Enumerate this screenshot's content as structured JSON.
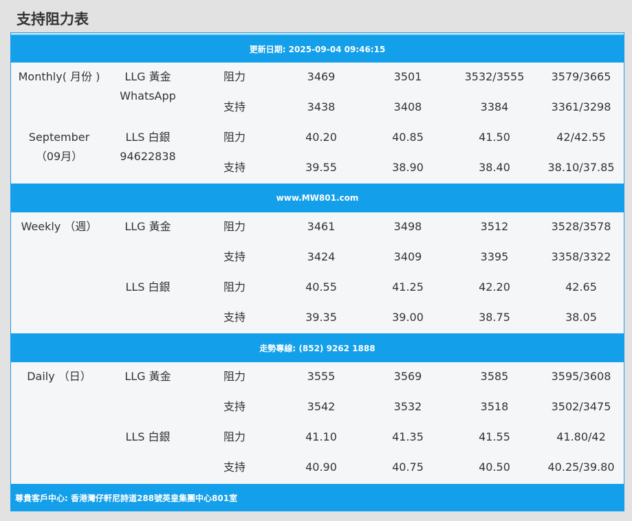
{
  "page_title": "支持阻力表",
  "banners": {
    "updated": "更新日期: 2025-09-04 09:46:15",
    "website": "www.MW801.com",
    "hotline": "走勢專線: (852) 9262 1888",
    "address": "尊貴客戶中心: 香港灣仔軒尼詩道288號英皇集團中心801室"
  },
  "monthly": {
    "period_line1": "Monthly( 月份 )",
    "period_line2": "September",
    "period_line3": "（09月）",
    "gold_label": "LLG 黃金",
    "gold_sub": "WhatsApp",
    "silver_label": "LLS 白銀",
    "silver_sub": "94622838",
    "rows": [
      {
        "type": "阻力",
        "values": [
          "3469",
          "3501",
          "3532/3555",
          "3579/3665"
        ]
      },
      {
        "type": "支持",
        "values": [
          "3438",
          "3408",
          "3384",
          "3361/3298"
        ]
      },
      {
        "type": "阻力",
        "values": [
          "40.20",
          "40.85",
          "41.50",
          "42/42.55"
        ]
      },
      {
        "type": "支持",
        "values": [
          "39.55",
          "38.90",
          "38.40",
          "38.10/37.85"
        ]
      }
    ]
  },
  "weekly": {
    "period_line1": "Weekly （週）",
    "gold_label": "LLG 黃金",
    "silver_label": "LLS 白銀",
    "rows": [
      {
        "type": "阻力",
        "values": [
          "3461",
          "3498",
          "3512",
          "3528/3578"
        ]
      },
      {
        "type": "支持",
        "values": [
          "3424",
          "3409",
          "3395",
          "3358/3322"
        ]
      },
      {
        "type": "阻力",
        "values": [
          "40.55",
          "41.25",
          "42.20",
          "42.65"
        ]
      },
      {
        "type": "支持",
        "values": [
          "39.35",
          "39.00",
          "38.75",
          "38.05"
        ]
      }
    ]
  },
  "daily": {
    "period_line1": "Daily （日）",
    "gold_label": "LLG 黃金",
    "silver_label": "LLS 白銀",
    "rows": [
      {
        "type": "阻力",
        "values": [
          "3555",
          "3569",
          "3585",
          "3595/3608"
        ]
      },
      {
        "type": "支持",
        "values": [
          "3542",
          "3532",
          "3518",
          "3502/3475"
        ]
      },
      {
        "type": "阻力",
        "values": [
          "41.10",
          "41.35",
          "41.55",
          "41.80/42"
        ]
      },
      {
        "type": "支持",
        "values": [
          "40.90",
          "40.75",
          "40.50",
          "40.25/39.80"
        ]
      }
    ]
  },
  "colors": {
    "banner": "#139fe9",
    "table_bg": "#f5f6f8",
    "page_bg": "#e2e2e2",
    "text": "#333333"
  }
}
